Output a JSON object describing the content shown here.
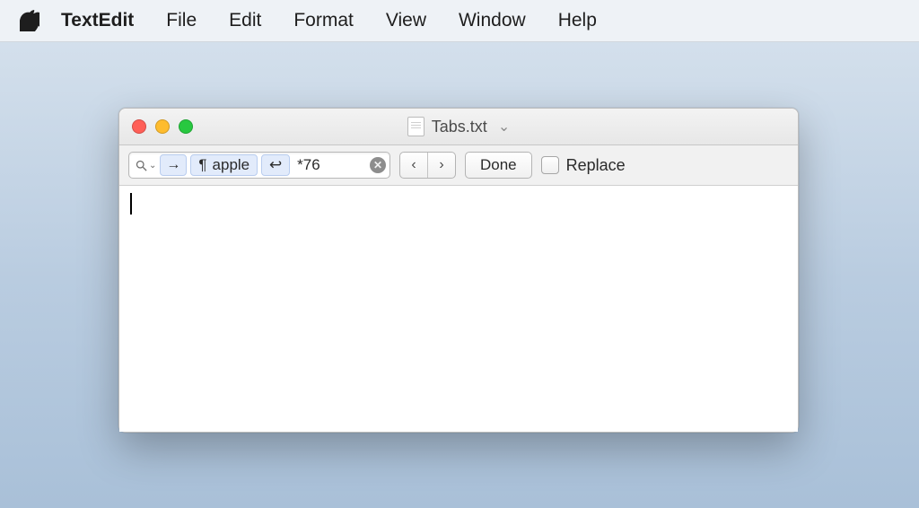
{
  "menubar": {
    "app_name": "TextEdit",
    "items": [
      "File",
      "Edit",
      "Format",
      "View",
      "Window",
      "Help"
    ]
  },
  "window": {
    "title": "Tabs.txt"
  },
  "findbar": {
    "tokens": {
      "tab_glyph": "→",
      "paragraph_glyph": "¶",
      "word": "apple",
      "return_glyph": "↩"
    },
    "trailing_text": "*76",
    "prev_glyph": "‹",
    "next_glyph": "›",
    "done_label": "Done",
    "replace_label": "Replace"
  },
  "document": {
    "content": ""
  }
}
